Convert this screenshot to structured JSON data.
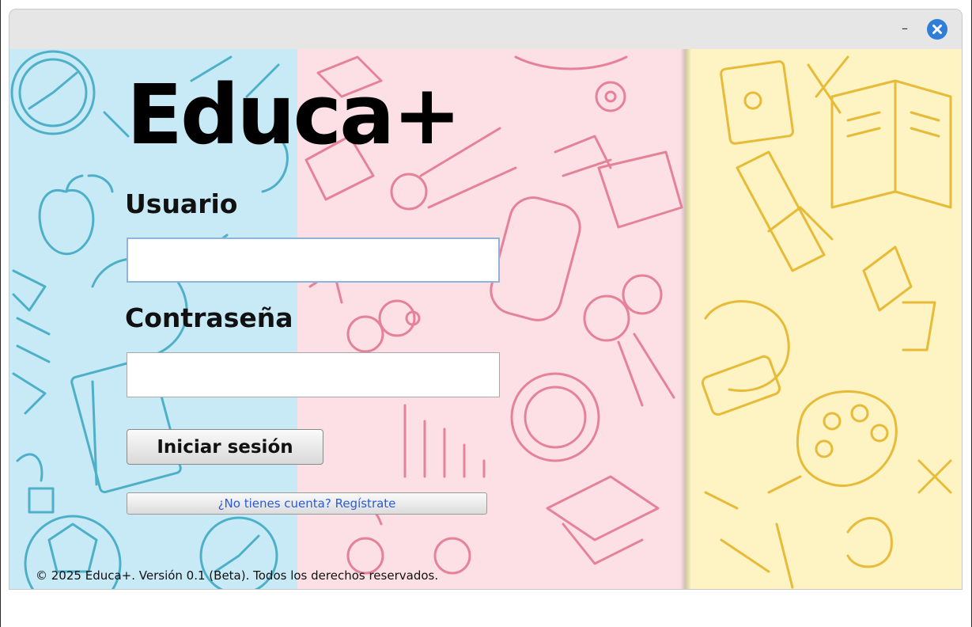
{
  "window": {
    "minimize_label": "–",
    "close_icon": "close-circle-icon",
    "accent_color": "#2f7fd8"
  },
  "background": {
    "panel_colors": [
      "#c7eaf6",
      "#fde0e6",
      "#fdf3c3"
    ],
    "doodle_colors": [
      "#3aa7c0",
      "#e06a86",
      "#e5b52a"
    ]
  },
  "login": {
    "title": "Educa+",
    "username_label": "Usuario",
    "username_value": "",
    "password_label": "Contraseña",
    "password_value": "",
    "login_button": "Iniciar sesión",
    "register_link": "¿No tienes cuenta?  Regístrate"
  },
  "footer": {
    "copyright": "© 2025 Educa+. Versión 0.1 (Beta). Todos los derechos reservados."
  }
}
